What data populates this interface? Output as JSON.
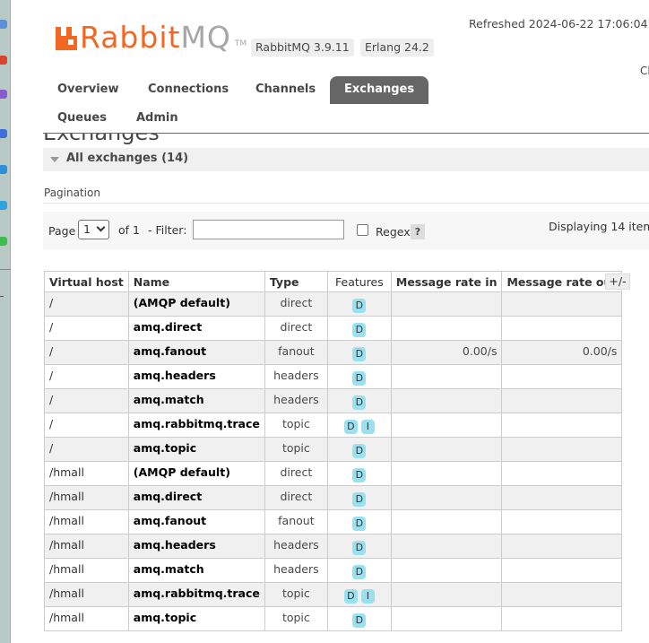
{
  "app": {
    "logo_brand": "Rabbit",
    "logo_mq": "MQ",
    "logo_tm": "TM",
    "rabbitmq_version": "RabbitMQ 3.9.11",
    "erlang_version": "Erlang 24.2",
    "refreshed": "Refreshed 2024-06-22 17:06:04",
    "cut_text": "Cl",
    "brand_color": "#f26723"
  },
  "nav": {
    "tabs": [
      {
        "label": "Overview",
        "active": false
      },
      {
        "label": "Connections",
        "active": false
      },
      {
        "label": "Channels",
        "active": false
      },
      {
        "label": "Exchanges",
        "active": true
      },
      {
        "label": "Queues",
        "active": false
      },
      {
        "label": "Admin",
        "active": false
      }
    ]
  },
  "page": {
    "title": "Exchanges",
    "section_title": "All exchanges (14)",
    "pagination_label": "Pagination"
  },
  "pager": {
    "page_label": "Page",
    "page_value": "1",
    "of_label": "of 1",
    "filter_label": "- Filter:",
    "filter_value": "",
    "regex_label": "Regex",
    "regex_checked": false,
    "help_label": "?",
    "displaying": "Displaying 14 item"
  },
  "table": {
    "columns": [
      "Virtual host",
      "Name",
      "Type",
      "Features",
      "Message rate in",
      "Message rate out"
    ],
    "toggle_label": "+/-",
    "rows": [
      {
        "vhost": "/",
        "name": "(AMQP default)",
        "type": "direct",
        "features": [
          "D"
        ],
        "rate_in": "",
        "rate_out": ""
      },
      {
        "vhost": "/",
        "name": "amq.direct",
        "type": "direct",
        "features": [
          "D"
        ],
        "rate_in": "",
        "rate_out": ""
      },
      {
        "vhost": "/",
        "name": "amq.fanout",
        "type": "fanout",
        "features": [
          "D"
        ],
        "rate_in": "0.00/s",
        "rate_out": "0.00/s"
      },
      {
        "vhost": "/",
        "name": "amq.headers",
        "type": "headers",
        "features": [
          "D"
        ],
        "rate_in": "",
        "rate_out": ""
      },
      {
        "vhost": "/",
        "name": "amq.match",
        "type": "headers",
        "features": [
          "D"
        ],
        "rate_in": "",
        "rate_out": ""
      },
      {
        "vhost": "/",
        "name": "amq.rabbitmq.trace",
        "type": "topic",
        "features": [
          "D",
          "I"
        ],
        "rate_in": "",
        "rate_out": ""
      },
      {
        "vhost": "/",
        "name": "amq.topic",
        "type": "topic",
        "features": [
          "D"
        ],
        "rate_in": "",
        "rate_out": ""
      },
      {
        "vhost": "/hmall",
        "name": "(AMQP default)",
        "type": "direct",
        "features": [
          "D"
        ],
        "rate_in": "",
        "rate_out": ""
      },
      {
        "vhost": "/hmall",
        "name": "amq.direct",
        "type": "direct",
        "features": [
          "D"
        ],
        "rate_in": "",
        "rate_out": ""
      },
      {
        "vhost": "/hmall",
        "name": "amq.fanout",
        "type": "fanout",
        "features": [
          "D"
        ],
        "rate_in": "",
        "rate_out": ""
      },
      {
        "vhost": "/hmall",
        "name": "amq.headers",
        "type": "headers",
        "features": [
          "D"
        ],
        "rate_in": "",
        "rate_out": ""
      },
      {
        "vhost": "/hmall",
        "name": "amq.match",
        "type": "headers",
        "features": [
          "D"
        ],
        "rate_in": "",
        "rate_out": ""
      },
      {
        "vhost": "/hmall",
        "name": "amq.rabbitmq.trace",
        "type": "topic",
        "features": [
          "D",
          "I"
        ],
        "rate_in": "",
        "rate_out": ""
      },
      {
        "vhost": "/hmall",
        "name": "amq.topic",
        "type": "topic",
        "features": [
          "D"
        ],
        "rate_in": "",
        "rate_out": ""
      }
    ]
  }
}
